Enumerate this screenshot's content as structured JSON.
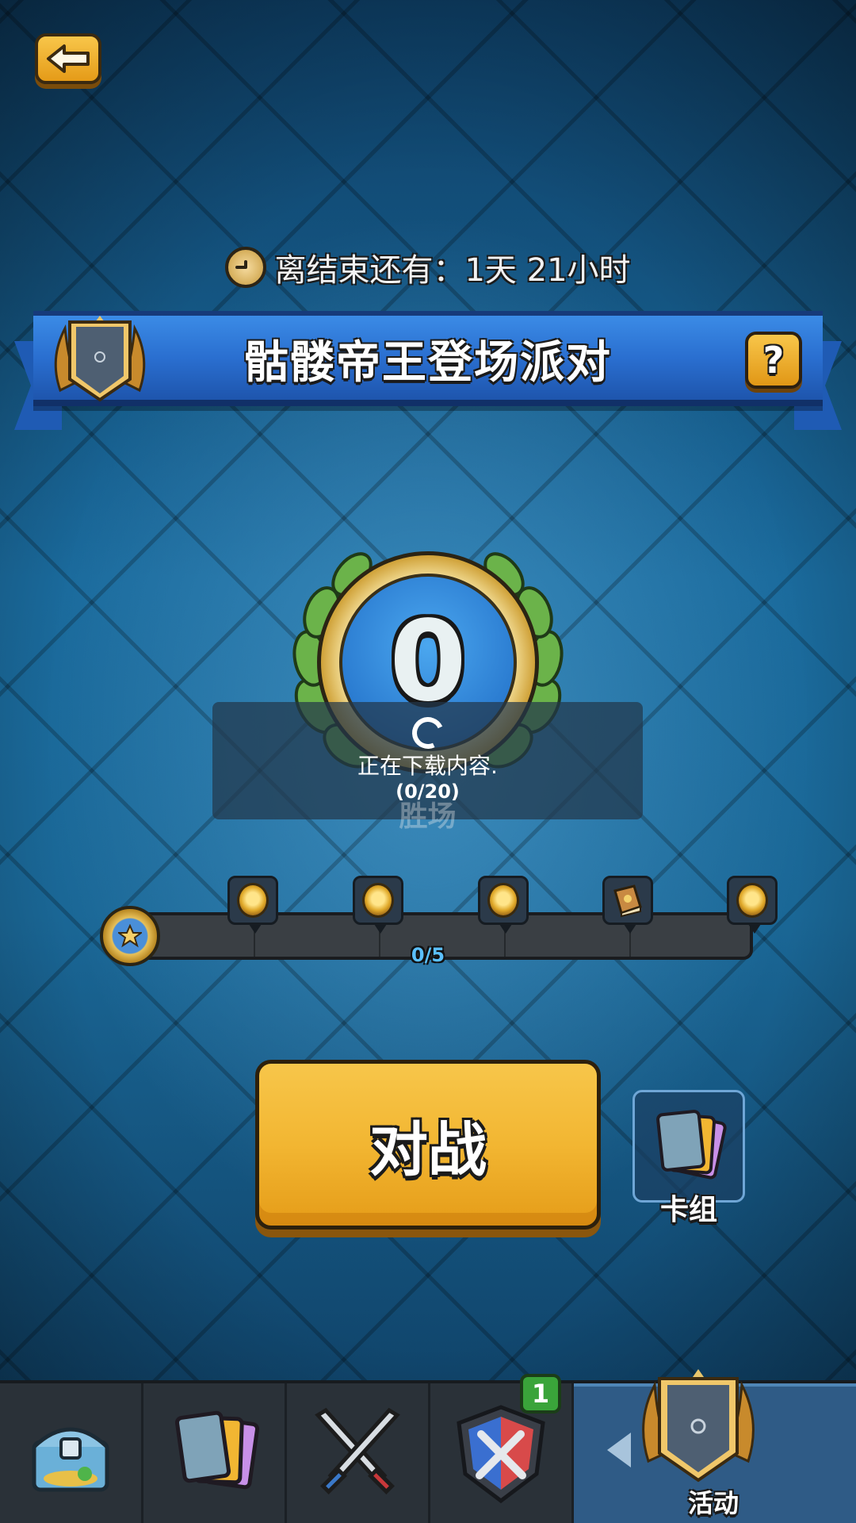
{
  "header": {
    "back_icon": "back-arrow-icon",
    "timer_icon": "clock-icon",
    "timer_text": "离结束还有：1天 21小时"
  },
  "event": {
    "title": "骷髅帝王登场派对",
    "help_label": "?",
    "badge_icon": "event-shield-icon"
  },
  "wins": {
    "value": "0",
    "label": "胜场"
  },
  "download": {
    "message": "正在下载内容.",
    "count": "(0/20)"
  },
  "progress": {
    "text": "0/5",
    "value": 0,
    "max": 5,
    "start_icon": "star-medal-icon",
    "rewards": [
      {
        "icon": "gold-coin-icon"
      },
      {
        "icon": "gold-coin-icon"
      },
      {
        "icon": "gold-coin-icon"
      },
      {
        "icon": "book-icon"
      },
      {
        "icon": "gold-coin-icon"
      }
    ]
  },
  "actions": {
    "battle_label": "对战",
    "deck_label": "卡组"
  },
  "nav": {
    "items": [
      {
        "icon": "chest-icon"
      },
      {
        "icon": "cards-icon"
      },
      {
        "icon": "crossed-swords-icon"
      },
      {
        "icon": "clan-war-shield-icon"
      }
    ],
    "clan_badge": "1",
    "active_label": "活动"
  },
  "colors": {
    "accent_gold": "#f2b632",
    "banner_blue": "#2a6fd0",
    "progress_text": "#5bc0ff",
    "badge_green": "#3aa43a"
  }
}
